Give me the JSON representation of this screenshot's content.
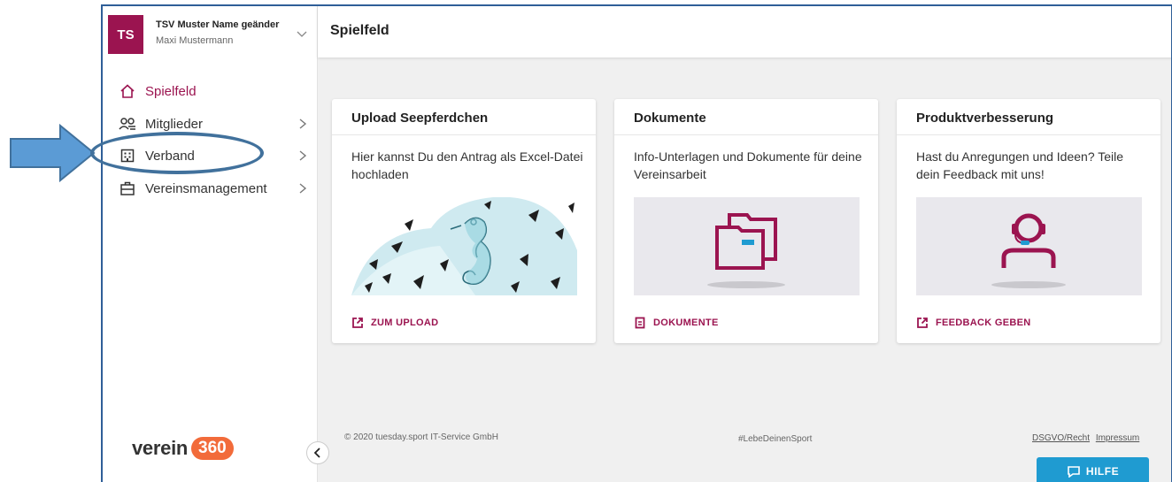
{
  "club": {
    "initials": "TS",
    "name": "TSV Muster Name geänder",
    "user": "Maxi Mustermann"
  },
  "nav": {
    "items": [
      {
        "label": "Spielfeld",
        "icon": "home-icon",
        "active": true
      },
      {
        "label": "Mitglieder",
        "icon": "members-icon"
      },
      {
        "label": "Verband",
        "icon": "building-icon"
      },
      {
        "label": "Vereinsmanagement",
        "icon": "briefcase-icon"
      }
    ]
  },
  "logo": {
    "text": "verein",
    "badge": "360"
  },
  "page": {
    "title": "Spielfeld"
  },
  "cards": [
    {
      "title": "Upload Seepferdchen",
      "text": "Hier kannst Du den Antrag als Excel-Datei hochladen",
      "action": "ZUM UPLOAD",
      "action_icon": "external-link-icon",
      "image": "seahorse-illustration"
    },
    {
      "title": "Dokumente",
      "text": "Info-Unterlagen und Dokumente für deine Vereinsarbeit",
      "action": "DOKUMENTE",
      "action_icon": "document-icon",
      "image": "folders-illustration"
    },
    {
      "title": "Produktverbesserung",
      "text": "Hast du Anregungen und Ideen? Teile dein Feedback mit uns!",
      "action": "FEEDBACK GEBEN",
      "action_icon": "external-link-icon",
      "image": "headset-person-illustration"
    }
  ],
  "footer": {
    "copyright": "© 2020 tuesday.sport IT-Service GmbH",
    "hashtag": "#LebeDeinenSport",
    "link_privacy": "DSGVO/Recht",
    "link_imprint": "Impressum"
  },
  "help": {
    "label": "HILFE"
  },
  "colors": {
    "brand": "#9b1450",
    "help": "#1f9bd1",
    "annotation": "#5b9bd5"
  }
}
